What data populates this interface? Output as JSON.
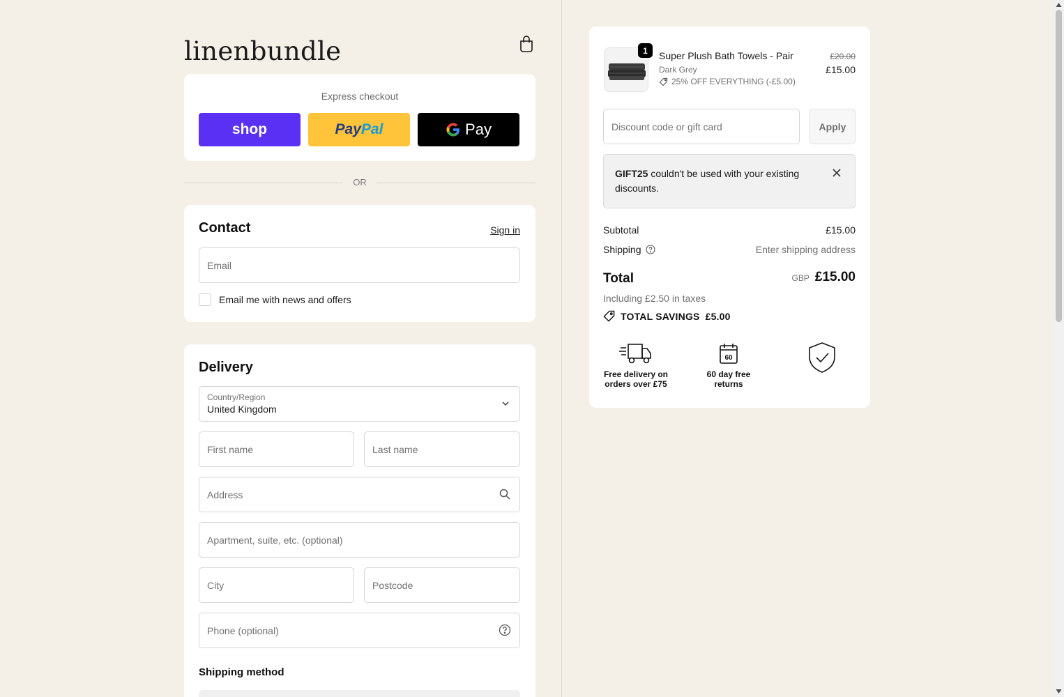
{
  "brand": {
    "logo_text": "linenbundle"
  },
  "express": {
    "title": "Express checkout",
    "shop_label": "shop",
    "paypal_label_1": "Pay",
    "paypal_label_2": "Pal",
    "gpay_label": "Pay",
    "or_text": "OR"
  },
  "contact": {
    "title": "Contact",
    "sign_in": "Sign in",
    "email_placeholder": "Email",
    "news_label": "Email me with news and offers"
  },
  "delivery": {
    "title": "Delivery",
    "country_label": "Country/Region",
    "country_value": "United Kingdom",
    "first_name": "First name",
    "last_name": "Last name",
    "address": "Address",
    "apartment": "Apartment, suite, etc. (optional)",
    "city": "City",
    "postcode": "Postcode",
    "phone": "Phone (optional)",
    "shipping_method": "Shipping method"
  },
  "summary": {
    "item": {
      "quantity": "1",
      "name": "Super Plush Bath Towels - Pair",
      "variant": "Dark Grey",
      "discount": "25% OFF EVERYTHING (-£5.00)",
      "old_price": "£20.00",
      "price": "£15.00"
    },
    "discount_placeholder": "Discount code or gift card",
    "apply_label": "Apply",
    "error_code": "GIFT25",
    "error_text": " couldn't be used with your existing discounts.",
    "subtotal_label": "Subtotal",
    "subtotal_value": "£15.00",
    "shipping_label": "Shipping",
    "shipping_value": "Enter shipping address",
    "total_label": "Total",
    "currency": "GBP",
    "total_value": "£15.00",
    "taxes_text": "Including £2.50 in taxes",
    "savings_label": "TOTAL SAVINGS",
    "savings_value": "£5.00",
    "badges": {
      "delivery_line1": "Free delivery on",
      "delivery_line2": "orders over £75",
      "returns_line1": "60 day free",
      "returns_line2": "returns",
      "calendar_number": "60"
    }
  },
  "colors": {
    "page_bg": "#f4f0e8",
    "shop_purple": "#5a31f4",
    "paypal_yellow": "#ffc439",
    "gpay_black": "#000000"
  }
}
